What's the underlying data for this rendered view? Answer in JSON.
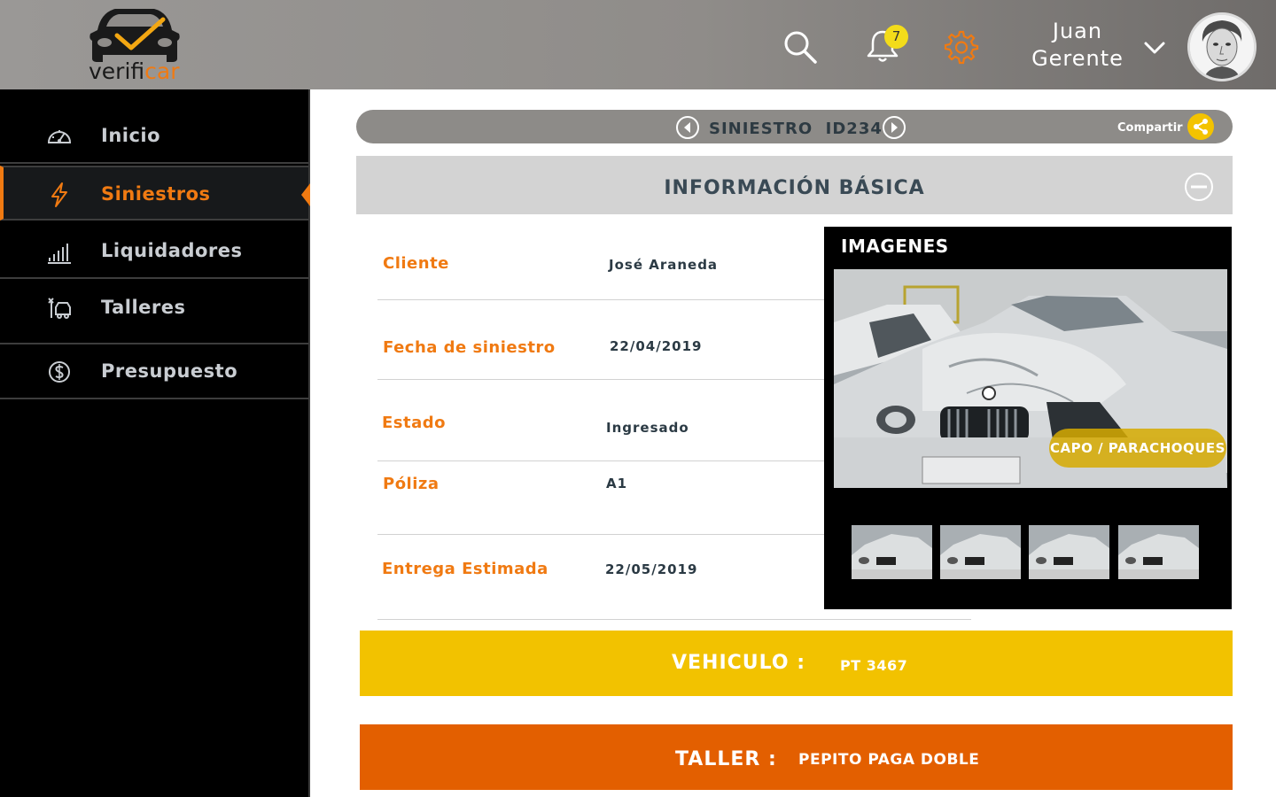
{
  "colors": {
    "accent": "#f07a12",
    "brand_yellow": "#f3c300",
    "sidebar_bg": "#000000",
    "vehiculo_band": "#f2c200",
    "taller_band": "#e35f00"
  },
  "header": {
    "logo_text_dark": "verifi",
    "logo_text_accent": "car",
    "search_icon": "search-icon",
    "notifications_icon": "bell-icon",
    "notifications_count": "7",
    "settings_icon": "gear-icon",
    "user": {
      "first_name": "Juan",
      "role": "Gerente",
      "chevron_icon": "chevron-down-icon"
    }
  },
  "sidebar": {
    "items": [
      {
        "label": "Inicio",
        "icon": "dashboard-gauge-icon",
        "active": false
      },
      {
        "label": "Siniestros",
        "icon": "lightning-icon",
        "active": true
      },
      {
        "label": "Liquidadores",
        "icon": "bar-chart-icon",
        "active": false
      },
      {
        "label": "Talleres",
        "icon": "workshop-icon",
        "active": false
      },
      {
        "label": "Presupuesto",
        "icon": "dollar-coin-icon",
        "active": false
      }
    ]
  },
  "claim_bar": {
    "title": "SINIESTRO  ID234",
    "prev_icon": "arrow-left-icon",
    "next_icon": "arrow-right-icon",
    "share_label": "Compartir",
    "share_icon": "share-icon"
  },
  "section": {
    "title": "INFORMACIÓN BÁSICA",
    "collapse_icon": "minus-circle-icon"
  },
  "fields": [
    {
      "label": "Cliente",
      "value": "José Araneda"
    },
    {
      "label": "Fecha de siniestro",
      "value": "22/04/2019"
    },
    {
      "label": "Estado",
      "value": "Ingresado"
    },
    {
      "label": "Póliza",
      "value": "A1"
    },
    {
      "label": "Entrega Estimada",
      "value": "22/05/2019"
    }
  ],
  "images": {
    "title": "IMAGENES",
    "photo_tag": "CAPO / PARACHOQUES",
    "thumbnail_count": 4
  },
  "vehiculo": {
    "label": "VEHICULO :",
    "value": "PT 3467"
  },
  "taller": {
    "label": "TALLER :",
    "value": "PEPITO PAGA DOBLE"
  }
}
